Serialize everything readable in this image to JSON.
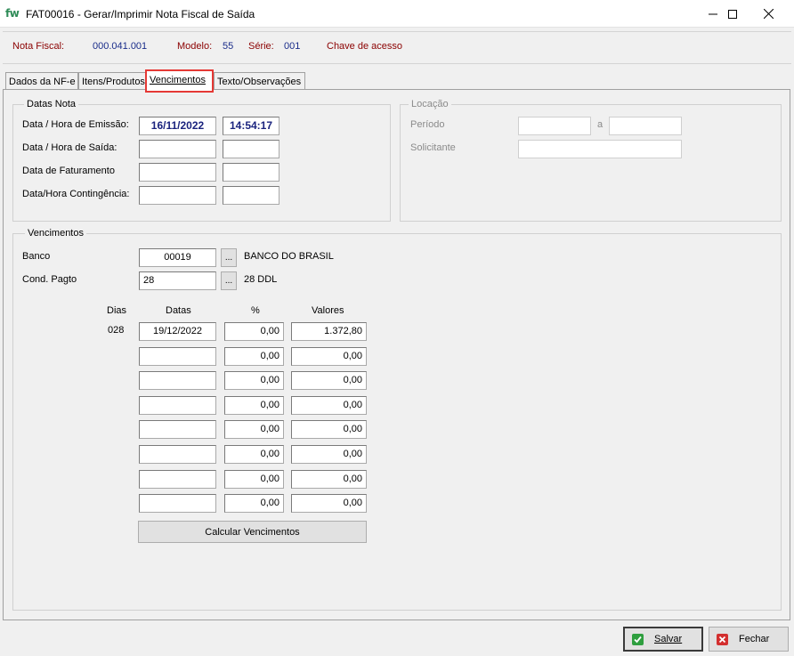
{
  "window": {
    "logo": "fw",
    "title": "FAT00016 - Gerar/Imprimir Nota Fiscal de Saída"
  },
  "header": {
    "nota_fiscal_label": "Nota Fiscal:",
    "nota_fiscal_value": "000.041.001",
    "modelo_label": "Modelo:",
    "modelo_value": "55",
    "serie_label": "Série:",
    "serie_value": "001",
    "chave_label": "Chave de acesso"
  },
  "tabs": [
    {
      "label": "Dados da NF-e",
      "active": false
    },
    {
      "label": "Itens/Produtos",
      "active": false
    },
    {
      "label": "Vencimentos",
      "active": true
    },
    {
      "label": "Texto/Observações",
      "active": false
    }
  ],
  "datas_nota": {
    "title": "Datas Nota",
    "emissao_label": "Data / Hora de Emissão:",
    "emissao_data": "16/11/2022",
    "emissao_hora": "14:54:17",
    "saida_label": "Data / Hora de Saída:",
    "saida_data": "",
    "saida_hora": "",
    "faturamento_label": "Data de Faturamento",
    "faturamento_data": "",
    "faturamento_hora": "",
    "contingencia_label": "Data/Hora Contingência:",
    "contingencia_data": "",
    "contingencia_hora": ""
  },
  "locacao": {
    "title": "Locação",
    "periodo_label": "Período",
    "periodo_de": "",
    "periodo_sep": "a",
    "periodo_ate": "",
    "solicitante_label": "Solicitante",
    "solicitante_value": ""
  },
  "vencimentos": {
    "title": "Vencimentos",
    "banco_label": "Banco",
    "banco_code": "00019",
    "banco_lookup": "...",
    "banco_name": "BANCO DO BRASIL",
    "cond_label": "Cond. Pagto",
    "cond_code": "28",
    "cond_lookup": "...",
    "cond_desc": "28 DDL",
    "col_dias": "Dias",
    "col_datas": "Datas",
    "col_pct": "%",
    "col_valores": "Valores",
    "rows": [
      {
        "dias": "028",
        "data": "19/12/2022",
        "pct": "0,00",
        "valor": "1.372,80"
      },
      {
        "dias": "",
        "data": "",
        "pct": "0,00",
        "valor": "0,00"
      },
      {
        "dias": "",
        "data": "",
        "pct": "0,00",
        "valor": "0,00"
      },
      {
        "dias": "",
        "data": "",
        "pct": "0,00",
        "valor": "0,00"
      },
      {
        "dias": "",
        "data": "",
        "pct": "0,00",
        "valor": "0,00"
      },
      {
        "dias": "",
        "data": "",
        "pct": "0,00",
        "valor": "0,00"
      },
      {
        "dias": "",
        "data": "",
        "pct": "0,00",
        "valor": "0,00"
      },
      {
        "dias": "",
        "data": "",
        "pct": "0,00",
        "valor": "0,00"
      }
    ],
    "calc_button": "Calcular Vencimentos"
  },
  "footer": {
    "save_label": "Salvar",
    "close_label": "Fechar"
  },
  "colors": {
    "header_label": "#8b0000",
    "header_value": "#1a2d8a",
    "tab_highlight": "#e53935",
    "save_icon": "#2e9e3e",
    "close_icon": "#d32f2f"
  },
  "icons": {
    "logo": "fw-logo-icon",
    "minimize": "minimize-icon",
    "maximize": "maximize-icon",
    "close": "close-icon",
    "save": "check-icon",
    "cancel": "x-icon"
  }
}
